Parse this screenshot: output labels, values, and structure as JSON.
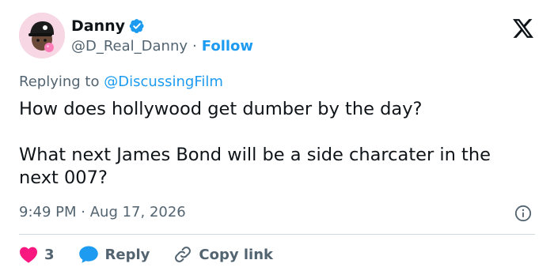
{
  "author": {
    "display_name": "Danny",
    "handle": "@D_Real_Danny",
    "separator": "·",
    "follow_label": "Follow"
  },
  "reply_context": {
    "prefix": "Replying to",
    "mention": "@DiscussingFilm"
  },
  "tweet": {
    "line1": "How does hollywood get dumber by the day?",
    "line2": "What next James Bond will be a side charcater in the next 007?"
  },
  "meta": {
    "time": "9:49 PM",
    "separator": "·",
    "date": "Aug 17, 2026"
  },
  "actions": {
    "like_count": "3",
    "reply_label": "Reply",
    "copy_label": "Copy link"
  },
  "colors": {
    "accent": "#1d9bf0",
    "like": "#f91880",
    "muted": "#536471",
    "text": "#0f1419"
  },
  "icons": {
    "verified": "verified-badge-icon",
    "brand": "x-logo-icon",
    "info": "info-icon",
    "like": "heart-icon",
    "reply": "speech-bubble-icon",
    "copy": "link-icon"
  }
}
